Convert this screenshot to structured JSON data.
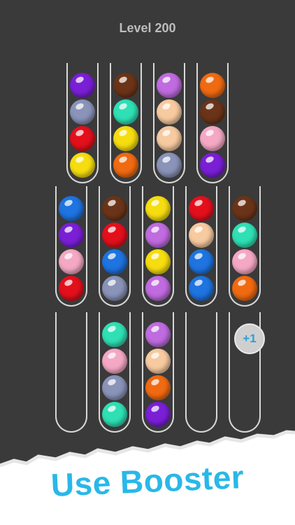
{
  "game": {
    "level_label": "Level 200",
    "add_tube_label": "+1",
    "booster_banner": "Use Booster"
  },
  "colors": {
    "purple": "#7a1fd6",
    "slate": "#8a93b8",
    "red": "#e3101c",
    "yellow": "#f6dd10",
    "brown": "#6b3418",
    "teal": "#2fe0b4",
    "orange": "#f06a12",
    "lavender": "#c06be0",
    "peach": "#f7caa0",
    "pink": "#f4a8c4",
    "blue": "#1e74e0",
    "tube_outline": "#d8d8d8",
    "board_background": "#3a3a3a",
    "banner_text": "#29b8e8"
  },
  "tubes": [
    {
      "row": 1,
      "balls_top_to_bottom": [
        "purple",
        "slate",
        "red",
        "yellow"
      ]
    },
    {
      "row": 1,
      "balls_top_to_bottom": [
        "brown",
        "teal",
        "yellow",
        "orange"
      ]
    },
    {
      "row": 1,
      "balls_top_to_bottom": [
        "lavender",
        "peach",
        "peach",
        "slate"
      ]
    },
    {
      "row": 1,
      "balls_top_to_bottom": [
        "orange",
        "brown",
        "pink",
        "purple"
      ]
    },
    {
      "row": 2,
      "balls_top_to_bottom": [
        "blue",
        "purple",
        "pink",
        "red"
      ]
    },
    {
      "row": 2,
      "balls_top_to_bottom": [
        "brown",
        "red",
        "blue",
        "slate"
      ]
    },
    {
      "row": 2,
      "balls_top_to_bottom": [
        "yellow",
        "lavender",
        "yellow",
        "lavender"
      ]
    },
    {
      "row": 2,
      "balls_top_to_bottom": [
        "red",
        "peach",
        "blue",
        "blue"
      ]
    },
    {
      "row": 2,
      "balls_top_to_bottom": [
        "brown",
        "teal",
        "pink",
        "orange"
      ]
    },
    {
      "row": 3,
      "balls_top_to_bottom": []
    },
    {
      "row": 3,
      "balls_top_to_bottom": [
        "teal",
        "pink",
        "slate",
        "teal"
      ]
    },
    {
      "row": 3,
      "balls_top_to_bottom": [
        "lavender",
        "peach",
        "orange",
        "purple"
      ]
    },
    {
      "row": 3,
      "balls_top_to_bottom": []
    },
    {
      "row": 3,
      "balls_top_to_bottom": []
    }
  ]
}
